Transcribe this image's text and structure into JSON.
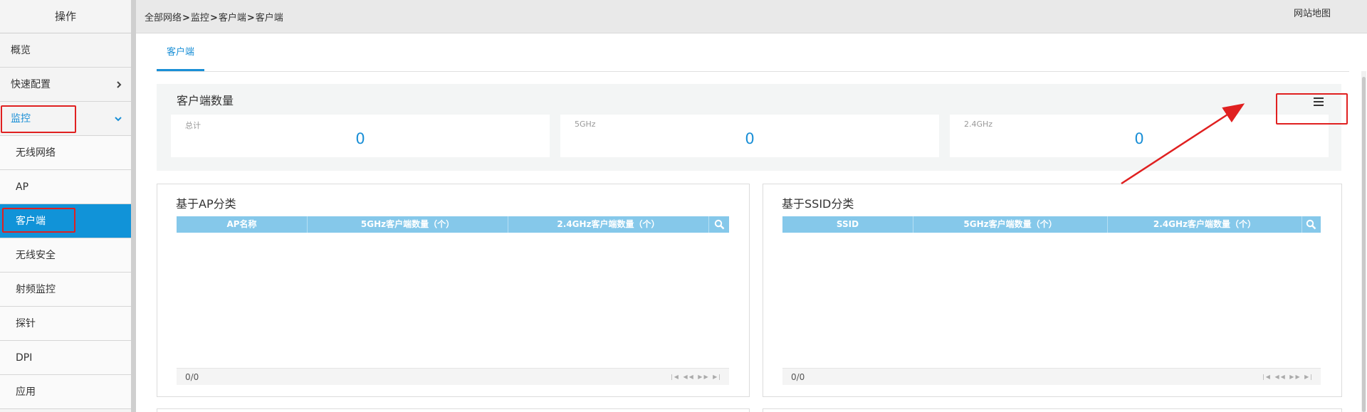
{
  "sidebar": {
    "header": "操作",
    "items": [
      {
        "label": "概览"
      },
      {
        "label": "快速配置",
        "chevron": "chevron-right-icon"
      },
      {
        "label": "监控",
        "chevron": "chevron-down-icon"
      },
      {
        "label": "无线网络"
      },
      {
        "label": "AP"
      },
      {
        "label": "客户端"
      },
      {
        "label": "无线安全"
      },
      {
        "label": "射频监控"
      },
      {
        "label": "探针"
      },
      {
        "label": "DPI"
      },
      {
        "label": "应用"
      }
    ]
  },
  "breadcrumb": [
    "全部网络",
    "监控",
    "客户端",
    "客户端"
  ],
  "breadcrumb_separator": ">",
  "sitemap_label": "网站地图",
  "tabs": [
    {
      "label": "客户端"
    }
  ],
  "client_count": {
    "title": "客户端数量",
    "cards": [
      {
        "label": "总计",
        "value": "0"
      },
      {
        "label": "5GHz",
        "value": "0"
      },
      {
        "label": "2.4GHz",
        "value": "0"
      }
    ],
    "list_icon": "list-icon"
  },
  "by_ap": {
    "title": "基于AP分类",
    "columns": [
      "AP名称",
      "5GHz客户端数量（个）",
      "2.4GHz客户端数量（个）"
    ],
    "pager": "0/0",
    "search_icon": "search-icon"
  },
  "by_ssid": {
    "title": "基于SSID分类",
    "columns": [
      "SSID",
      "5GHz客户端数量（个）",
      "2.4GHz客户端数量（个）"
    ],
    "pager": "0/0",
    "search_icon": "search-icon"
  },
  "colors": {
    "accent": "#1a8fd6",
    "active_nav": "#1193d8",
    "grid_header": "#85c8ea",
    "annotation": "#e02020"
  }
}
